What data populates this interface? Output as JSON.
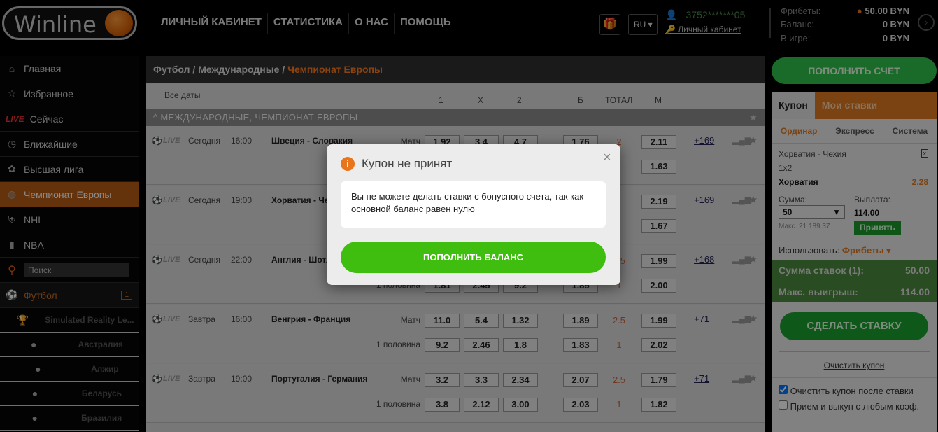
{
  "header": {
    "logo": "Winline",
    "nav": [
      "ЛИЧНЫЙ КАБИНЕТ",
      "СТАТИСТИКА",
      "О НАС",
      "ПОМОЩЬ"
    ],
    "lang": "RU",
    "phone": "+3752*******05",
    "cabinet_link": "Личный кабинет",
    "balances": [
      {
        "label": "Фрибеты:",
        "value": "50.00 BYN"
      },
      {
        "label": "Баланс:",
        "value": "0 BYN"
      },
      {
        "label": "В игре:",
        "value": "0 BYN"
      }
    ]
  },
  "sidebar": {
    "items": [
      {
        "label": "Главная",
        "icon": "home"
      },
      {
        "label": "Избранное",
        "icon": "star"
      },
      {
        "label": "Сейчас",
        "icon": "LIVE"
      },
      {
        "label": "Ближайшие",
        "icon": "clock"
      },
      {
        "label": "Высшая лига",
        "icon": "emblem"
      },
      {
        "label": "Чемпионат Европы",
        "icon": "euro",
        "active": true
      },
      {
        "label": "NHL",
        "icon": "nhl"
      },
      {
        "label": "NBA",
        "icon": "nba"
      }
    ],
    "search_placeholder": "Поиск",
    "sport": {
      "label": "Футбол",
      "count": "1"
    },
    "leagues": [
      {
        "label": "Simulated Reality Le...",
        "icon": "trophy"
      },
      {
        "label": "Австралия",
        "icon": "flag"
      },
      {
        "label": "Алжир",
        "icon": "flag"
      },
      {
        "label": "Беларусь",
        "icon": "flag"
      },
      {
        "label": "Бразилия",
        "icon": "flag"
      }
    ]
  },
  "main": {
    "breadcrumb": [
      "Футбол",
      "Международные"
    ],
    "breadcrumb_current": "Чемпионат Европы",
    "all_dates": "Все даты",
    "columns": [
      "1",
      "X",
      "2",
      "Б",
      "ТОТАЛ",
      "М"
    ],
    "group": "МЕЖДУНАРОДНЫЕ, ЧЕМПИОНАТ ЕВРОПЫ",
    "live": "LIVE",
    "events": [
      {
        "day": "Сегодня",
        "time": "16:00",
        "teams": "Швеция - Словакия",
        "more": "+169",
        "lines": [
          {
            "label": "Матч",
            "o1": "1.92",
            "x": "3.4",
            "o2": "4.7",
            "b": "1.76",
            "total": "2",
            "m": "2.11"
          },
          {
            "label": "",
            "o1": "",
            "x": "",
            "o2": "",
            "b": "",
            "total": "",
            "m": "1.63"
          }
        ]
      },
      {
        "day": "Сегодня",
        "time": "19:00",
        "teams": "Хорватия - Чехия",
        "more": "+169",
        "lines": [
          {
            "label": "",
            "o1": "",
            "x": "",
            "o2": "",
            "b": "",
            "total": "",
            "m": "2.19"
          },
          {
            "label": "",
            "o1": "",
            "x": "",
            "o2": "",
            "b": "",
            "total": "",
            "m": "1.67"
          }
        ]
      },
      {
        "day": "Сегодня",
        "time": "22:00",
        "teams": "Англия - Шотландия",
        "more": "+168",
        "lines": [
          {
            "label": "",
            "o1": "",
            "x": "",
            "o2": "",
            "b": "",
            "total": "2.5",
            "m": "1.99"
          },
          {
            "label": "1 половина",
            "o1": "1.81",
            "x": "2.45",
            "o2": "9.2",
            "b": "1.85",
            "total": "1",
            "m": "2.00"
          }
        ]
      },
      {
        "day": "Завтра",
        "time": "16:00",
        "teams": "Венгрия - Франция",
        "more": "+71",
        "lines": [
          {
            "label": "Матч",
            "o1": "11.0",
            "x": "5.4",
            "o2": "1.32",
            "b": "1.89",
            "total": "2.5",
            "m": "1.99"
          },
          {
            "label": "1 половина",
            "o1": "9.2",
            "x": "2.46",
            "o2": "1.8",
            "b": "1.83",
            "total": "1",
            "m": "2.02"
          }
        ]
      },
      {
        "day": "Завтра",
        "time": "19:00",
        "teams": "Португалия - Германия",
        "more": "+71",
        "lines": [
          {
            "label": "Матч",
            "o1": "3.2",
            "x": "3.3",
            "o2": "2.34",
            "b": "2.07",
            "total": "2.5",
            "m": "1.79"
          },
          {
            "label": "1 половина",
            "o1": "3.8",
            "x": "2.12",
            "o2": "3.00",
            "b": "2.03",
            "total": "1",
            "m": "1.82"
          }
        ]
      }
    ]
  },
  "coupon": {
    "topup": "ПОПОЛНИТЬ СЧЕТ",
    "tabs": [
      "Купон",
      "Мои ставки"
    ],
    "types": [
      "Ординар",
      "Экспресс",
      "Система"
    ],
    "event": "Хорватия - Чехия",
    "market": "1х2",
    "pick": "Хорватия",
    "odds": "2.28",
    "sum_label": "Сумма:",
    "sum": "50",
    "max": "Макс. 21 189.37",
    "payout_label": "Выплата:",
    "payout": "114.00",
    "accept": "Принять",
    "use_label": "Использовать:",
    "use_value": "Фрибеты",
    "total_label": "Сумма ставок (1):",
    "total": "50.00",
    "maxwin_label": "Макс. выигрыш:",
    "maxwin": "114.00",
    "bet": "СДЕЛАТЬ СТАВКУ",
    "clear": "Очистить купон",
    "opt1": "Очистить купон после ставки",
    "opt2": "Прием и выкуп с любым коэф."
  },
  "modal": {
    "title": "Купон не принят",
    "message": "Вы не можете делать ставки с бонусного счета, так как основной баланс равен нулю",
    "button": "ПОПОЛНИТЬ БАЛАНС"
  },
  "colors": {
    "accent": "#e07a20",
    "green": "#3fbe0f"
  }
}
